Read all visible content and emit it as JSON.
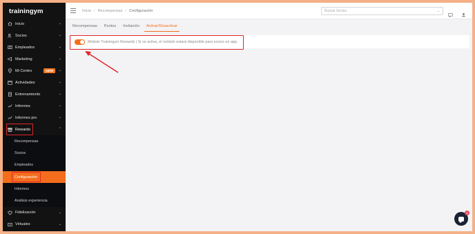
{
  "brand": {
    "name": "trainingym"
  },
  "sidebar": {
    "items": [
      {
        "label": "Inicio",
        "icon": "home-icon"
      },
      {
        "label": "Socios",
        "icon": "users-icon"
      },
      {
        "label": "Empleados",
        "icon": "id-card-icon"
      },
      {
        "label": "Marketing",
        "icon": "megaphone-icon"
      },
      {
        "label": "Mi Centro",
        "icon": "location-icon",
        "badge": "NEW"
      },
      {
        "label": "Actividades",
        "icon": "calendar-icon"
      },
      {
        "label": "Entrenamiento",
        "icon": "clipboard-icon"
      },
      {
        "label": "Informes",
        "icon": "chart-icon"
      },
      {
        "label": "Informes pro",
        "icon": "chart-pro-icon"
      },
      {
        "label": "Rewards",
        "icon": "gift-icon"
      }
    ],
    "rewards_submenu": [
      "Recompensas",
      "Socios",
      "Empleados",
      "Configuración",
      "Informes",
      "Análisis experiencia"
    ],
    "bottom_items": [
      {
        "label": "Fidelización",
        "icon": "heart-icon"
      },
      {
        "label": "Virtuales",
        "icon": "play-icon"
      }
    ]
  },
  "topbar": {
    "breadcrumb": [
      "Inicio",
      "Recompensas",
      "Configuración"
    ],
    "separator": "/",
    "search_placeholder": "Buscar Socios"
  },
  "tabs": [
    "Recompensas",
    "Puntos",
    "Invitación",
    "Activar/Desactivar"
  ],
  "active_tab": "Activar/Desactivar",
  "module": {
    "enabled": true,
    "text": "Módulo Trainingym Rewards | Si se activa, el módulo estará disponible para socios en app."
  },
  "chat": {
    "notifications": "1"
  },
  "colors": {
    "accent": "#f46d1c",
    "sidebar": "#121212",
    "highlight": "#e0262b",
    "frame": "#f4b086"
  }
}
